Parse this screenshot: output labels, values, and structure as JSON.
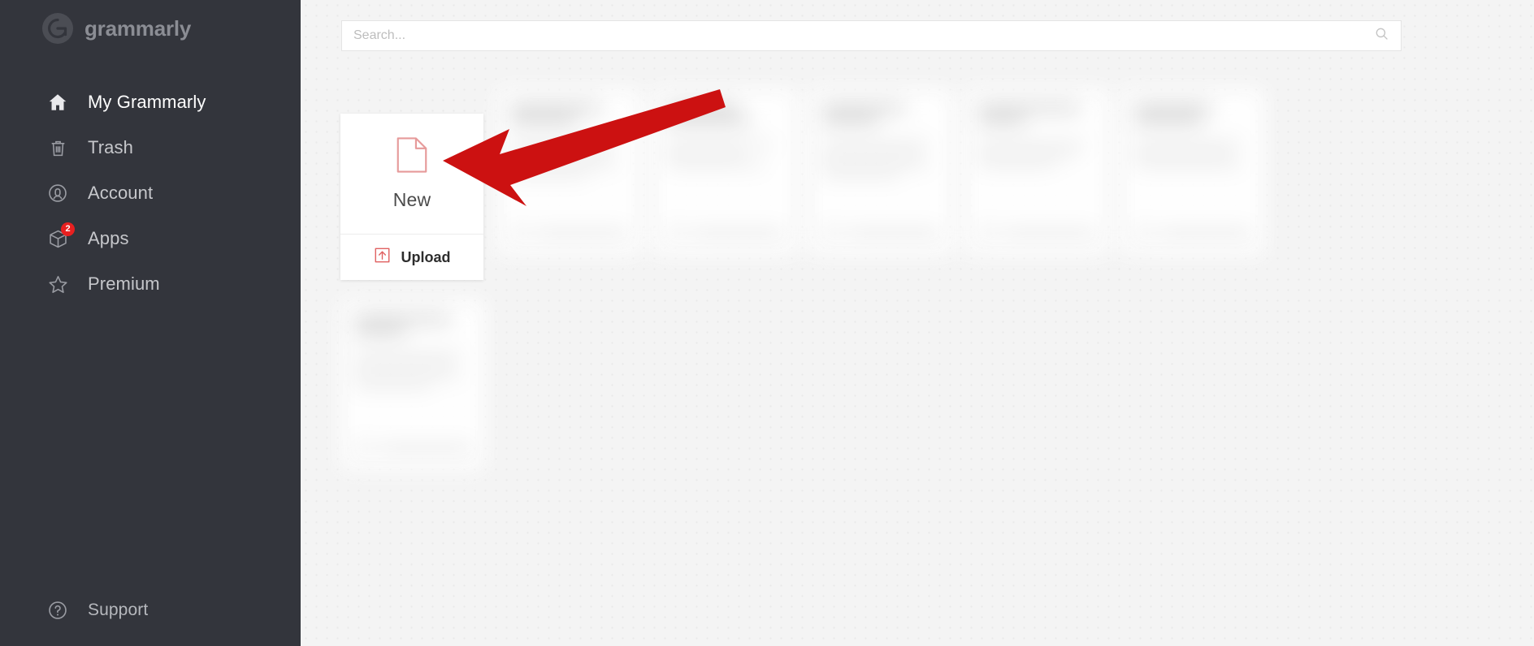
{
  "app": {
    "brand_name": "grammarly",
    "brand_mark_icon": "grammarly-g-logo-icon"
  },
  "sidebar": {
    "items": [
      {
        "label": "My Grammarly",
        "icon": "home-icon",
        "active": true,
        "badge": ""
      },
      {
        "label": "Trash",
        "icon": "trash-icon",
        "active": false,
        "badge": ""
      },
      {
        "label": "Account",
        "icon": "account-icon",
        "active": false,
        "badge": ""
      },
      {
        "label": "Apps",
        "icon": "apps-box-icon",
        "active": false,
        "badge": "2"
      },
      {
        "label": "Premium",
        "icon": "star-icon",
        "active": false,
        "badge": ""
      }
    ],
    "bottom": {
      "label": "Support",
      "icon": "help-circle-icon"
    }
  },
  "search": {
    "placeholder": "Search...",
    "value": "",
    "icon": "search-icon"
  },
  "new_card": {
    "new_label": "New",
    "new_icon": "document-page-icon",
    "upload_label": "Upload",
    "upload_icon": "upload-arrow-icon"
  },
  "annotation": {
    "arrow_icon": "red-pointer-arrow-icon",
    "arrow_color": "#cc1111",
    "points_to": "New"
  },
  "colors": {
    "sidebar_bg": "#33353c",
    "main_bg": "#f4f4f4",
    "card_bg": "#ffffff",
    "accent_red": "#cc1111",
    "badge_red": "#e82020",
    "icon_salmon": "#e69a9a"
  },
  "documents": {
    "row1": [
      {
        "placeholder": true
      },
      {
        "placeholder": true
      },
      {
        "placeholder": true
      },
      {
        "placeholder": true
      },
      {
        "placeholder": true
      },
      {
        "placeholder": true
      }
    ],
    "row2": [
      {
        "placeholder": true
      }
    ]
  }
}
